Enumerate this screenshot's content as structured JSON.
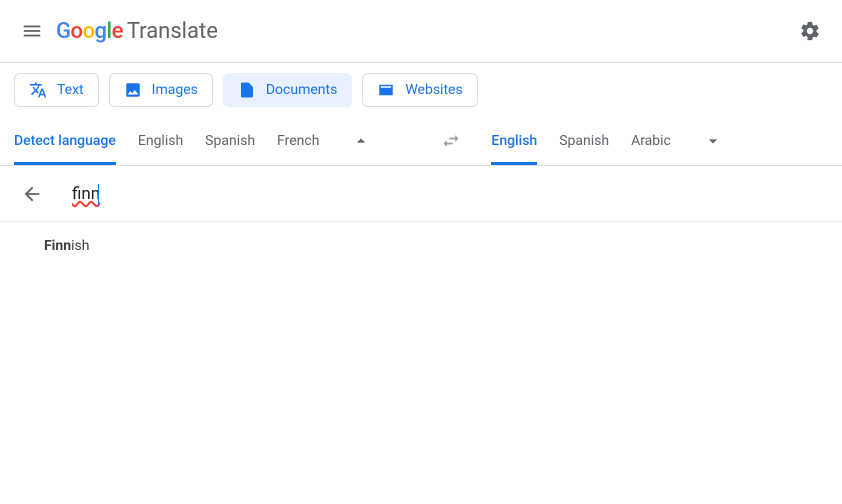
{
  "header": {
    "logo_app": "Translate"
  },
  "tabs": {
    "text": "Text",
    "images": "Images",
    "documents": "Documents",
    "websites": "Websites",
    "active": "documents"
  },
  "source_langs": {
    "detect": "Detect language",
    "l1": "English",
    "l2": "Spanish",
    "l3": "French",
    "selected": "detect"
  },
  "target_langs": {
    "l1": "English",
    "l2": "Spanish",
    "l3": "Arabic",
    "selected": "l1"
  },
  "language_search": {
    "query": "finn",
    "suggestion_prefix": "Finn",
    "suggestion_suffix": "ish"
  }
}
